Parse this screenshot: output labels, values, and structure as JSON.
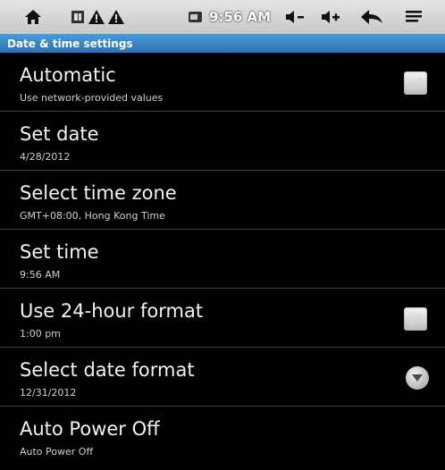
{
  "status_bar": {
    "clock": "9:56 AM",
    "icons": [
      "home-icon",
      "sim-icon",
      "warning-icon",
      "warning-icon",
      "battery-icon",
      "volume-down-icon",
      "volume-up-icon",
      "back-icon",
      "menu-icon"
    ]
  },
  "title_bar": {
    "title": "Date & time settings",
    "color": "#3a86c8"
  },
  "settings": [
    {
      "title": "Automatic",
      "summary": "Use network-provided values",
      "control": "checkbox"
    },
    {
      "title": "Set date",
      "summary": "4/28/2012",
      "control": "none"
    },
    {
      "title": "Select time zone",
      "summary": "GMT+08:00, Hong Kong Time",
      "control": "none"
    },
    {
      "title": "Set time",
      "summary": "9:56 AM",
      "control": "none"
    },
    {
      "title": "Use 24-hour format",
      "summary": "1:00 pm",
      "control": "checkbox"
    },
    {
      "title": "Select date format",
      "summary": "12/31/2012",
      "control": "dropdown"
    },
    {
      "title": "Auto Power Off",
      "summary": "Auto Power Off",
      "control": "none"
    }
  ]
}
